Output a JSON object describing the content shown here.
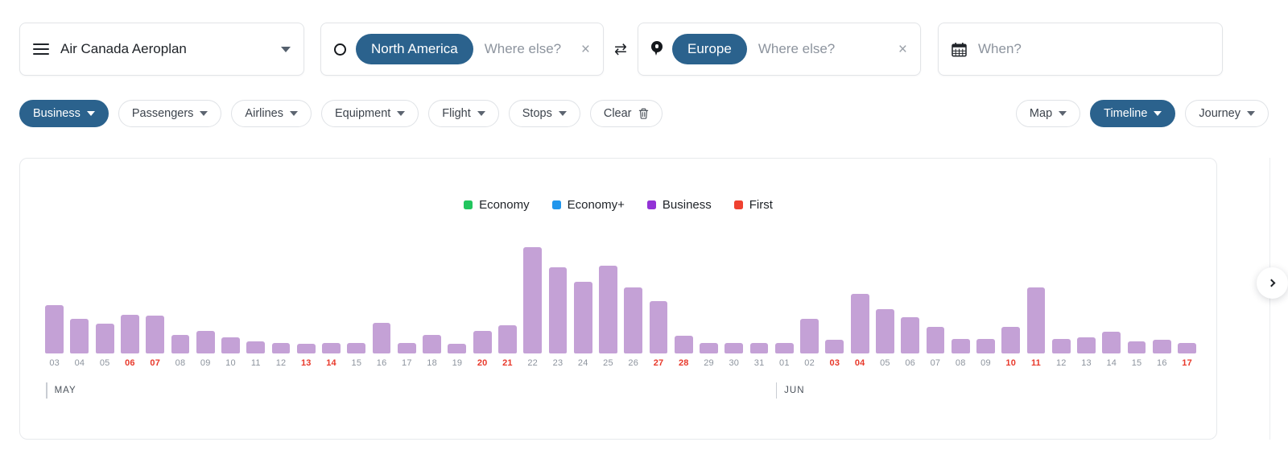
{
  "search": {
    "airline": {
      "menu_icon": "hamburger-icon",
      "value": "Air Canada Aeroplan",
      "chevron": "chevron-down-icon"
    },
    "origin": {
      "icon": "circle-icon",
      "pill": "North America",
      "placeholder": "Where else?",
      "clear": "×"
    },
    "swap": "⇄",
    "destination": {
      "icon": "map-pin-icon",
      "pill": "Europe",
      "placeholder": "Where else?",
      "clear": "×"
    },
    "when": {
      "icon": "calendar-icon",
      "placeholder": "When?"
    }
  },
  "filters": {
    "left": [
      {
        "label": "Business",
        "active": true,
        "chevron": true
      },
      {
        "label": "Passengers",
        "active": false,
        "chevron": true
      },
      {
        "label": "Airlines",
        "active": false,
        "chevron": true
      },
      {
        "label": "Equipment",
        "active": false,
        "chevron": true
      },
      {
        "label": "Flight",
        "active": false,
        "chevron": true
      },
      {
        "label": "Stops",
        "active": false,
        "chevron": true
      },
      {
        "label": "Clear",
        "active": false,
        "chevron": false,
        "trash": true
      }
    ],
    "right": [
      {
        "label": "Map",
        "active": false,
        "chevron": true
      },
      {
        "label": "Timeline",
        "active": true,
        "chevron": true
      },
      {
        "label": "Journey",
        "active": false,
        "chevron": true
      }
    ]
  },
  "edge_button": {
    "icon": "chevron-right-icon"
  },
  "chart_data": {
    "type": "bar",
    "title": "",
    "xlabel": "",
    "ylabel": "",
    "grid": false,
    "legend_position": "top-center",
    "legend": [
      {
        "name": "Economy",
        "color": "#22c55e"
      },
      {
        "name": "Economy+",
        "color": "#2196ec"
      },
      {
        "name": "Business",
        "color": "#9333d6"
      },
      {
        "name": "First",
        "color": "#ef4130"
      }
    ],
    "bar_color": "#c4a1d6",
    "ylim": [
      0,
      100
    ],
    "months": [
      {
        "label": "MAY",
        "start_index": 0
      },
      {
        "label": "JUN",
        "start_index": 29
      }
    ],
    "categories": [
      "03",
      "04",
      "05",
      "06",
      "07",
      "08",
      "09",
      "10",
      "11",
      "12",
      "13",
      "14",
      "15",
      "16",
      "17",
      "18",
      "19",
      "20",
      "21",
      "22",
      "23",
      "24",
      "25",
      "26",
      "27",
      "28",
      "29",
      "30",
      "31",
      "01",
      "02",
      "03",
      "04",
      "05",
      "06",
      "07",
      "08",
      "09",
      "10",
      "11",
      "12",
      "13",
      "14",
      "15",
      "16",
      "17"
    ],
    "weekend_flags": [
      false,
      false,
      false,
      true,
      true,
      false,
      false,
      false,
      false,
      false,
      true,
      true,
      false,
      false,
      false,
      false,
      false,
      true,
      true,
      false,
      false,
      false,
      false,
      false,
      true,
      true,
      false,
      false,
      false,
      false,
      false,
      true,
      true,
      false,
      false,
      false,
      false,
      false,
      true,
      true,
      false,
      false,
      false,
      false,
      false,
      true
    ],
    "values": [
      36,
      26,
      22,
      29,
      28,
      14,
      17,
      12,
      9,
      8,
      7,
      8,
      8,
      23,
      8,
      14,
      7,
      17,
      21,
      79,
      64,
      53,
      65,
      49,
      39,
      13,
      8,
      8,
      8,
      8,
      26,
      10,
      44,
      33,
      27,
      20,
      11,
      11,
      20,
      49,
      11,
      12,
      16,
      9,
      10,
      8
    ]
  }
}
